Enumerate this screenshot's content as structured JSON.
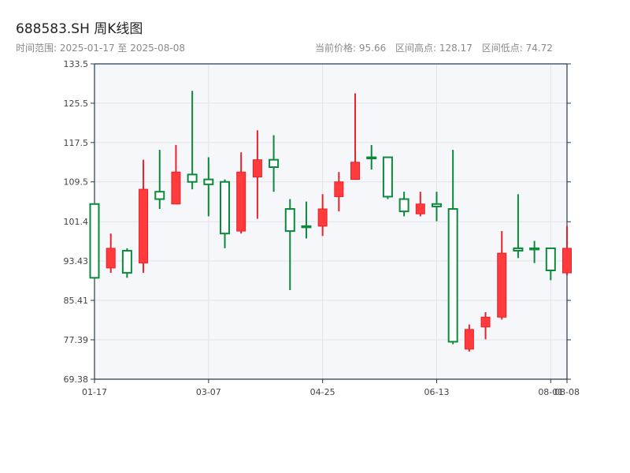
{
  "header": {
    "title": "688583.SH 周K线图",
    "date_range": "时间范围: 2025-01-17 至 2025-08-08",
    "current_price": "当前价格: 95.66",
    "range_high": "区间高点: 128.17",
    "range_low": "区间低点: 74.72"
  },
  "colors": {
    "up": "#e8212a",
    "up_fill": "#ff3b3b",
    "down": "#0a8a3a",
    "plot_bg": "#f5f7fa",
    "grid": "#e1e4e8",
    "axis": "#2b3a4a"
  },
  "chart_data": {
    "type": "candlestick",
    "title": "688583.SH 周K线图",
    "xlabel": "",
    "ylabel": "",
    "ylim": [
      69.38,
      133.5
    ],
    "y_ticks": [
      "69.38",
      "77.39",
      "85.41",
      "93.43",
      "101.4",
      "109.5",
      "117.5",
      "125.5",
      "133.5"
    ],
    "x_ticks": [
      "01-17",
      "03-07",
      "04-25",
      "06-13",
      "08-01",
      "08-08"
    ],
    "grid": true,
    "candles": [
      {
        "date": "2025-01-17",
        "open": 90.0,
        "close": 105.0,
        "high": 105.0,
        "low": 90.0
      },
      {
        "date": "2025-01-24",
        "open": 96.0,
        "close": 92.0,
        "high": 99.0,
        "low": 91.0
      },
      {
        "date": "2025-01-31",
        "open": 91.0,
        "close": 95.5,
        "high": 96.0,
        "low": 90.0
      },
      {
        "date": "2025-02-07",
        "open": 108.0,
        "close": 93.0,
        "high": 114.0,
        "low": 91.0
      },
      {
        "date": "2025-02-14",
        "open": 106.0,
        "close": 107.5,
        "high": 116.0,
        "low": 104.0
      },
      {
        "date": "2025-02-21",
        "open": 111.5,
        "close": 105.0,
        "high": 117.0,
        "low": 105.0
      },
      {
        "date": "2025-02-28",
        "open": 109.5,
        "close": 111.0,
        "high": 128.0,
        "low": 108.0
      },
      {
        "date": "2025-03-07",
        "open": 109.0,
        "close": 110.0,
        "high": 114.5,
        "low": 102.5
      },
      {
        "date": "2025-03-14",
        "open": 99.0,
        "close": 109.5,
        "high": 110.0,
        "low": 96.0
      },
      {
        "date": "2025-03-21",
        "open": 111.5,
        "close": 99.5,
        "high": 115.5,
        "low": 99.0
      },
      {
        "date": "2025-03-28",
        "open": 114.0,
        "close": 110.5,
        "high": 120.0,
        "low": 102.0
      },
      {
        "date": "2025-04-04",
        "open": 112.5,
        "close": 114.0,
        "high": 119.0,
        "low": 107.5
      },
      {
        "date": "2025-04-11",
        "open": 99.5,
        "close": 104.0,
        "high": 106.0,
        "low": 87.5
      },
      {
        "date": "2025-04-18",
        "open": 100.5,
        "close": 100.5,
        "high": 105.5,
        "low": 98.0
      },
      {
        "date": "2025-04-25",
        "open": 104.0,
        "close": 100.5,
        "high": 107.0,
        "low": 98.5
      },
      {
        "date": "2025-05-02",
        "open": 109.5,
        "close": 106.5,
        "high": 111.5,
        "low": 103.5
      },
      {
        "date": "2025-05-09",
        "open": 113.5,
        "close": 110.0,
        "high": 127.5,
        "low": 110.0
      },
      {
        "date": "2025-05-16",
        "open": 114.5,
        "close": 114.5,
        "high": 117.0,
        "low": 112.0
      },
      {
        "date": "2025-05-23",
        "open": 106.5,
        "close": 114.5,
        "high": 114.5,
        "low": 106.0
      },
      {
        "date": "2025-05-30",
        "open": 103.5,
        "close": 106.0,
        "high": 107.5,
        "low": 102.5
      },
      {
        "date": "2025-06-06",
        "open": 105.0,
        "close": 103.0,
        "high": 107.5,
        "low": 102.5
      },
      {
        "date": "2025-06-13",
        "open": 104.5,
        "close": 105.0,
        "high": 107.5,
        "low": 101.5
      },
      {
        "date": "2025-06-20",
        "open": 77.0,
        "close": 104.0,
        "high": 116.0,
        "low": 76.5
      },
      {
        "date": "2025-06-27",
        "open": 79.5,
        "close": 75.5,
        "high": 80.5,
        "low": 75.0
      },
      {
        "date": "2025-07-04",
        "open": 82.0,
        "close": 80.0,
        "high": 83.0,
        "low": 77.5
      },
      {
        "date": "2025-07-11",
        "open": 95.0,
        "close": 82.0,
        "high": 99.5,
        "low": 81.5
      },
      {
        "date": "2025-07-18",
        "open": 95.5,
        "close": 96.0,
        "high": 107.0,
        "low": 94.0
      },
      {
        "date": "2025-07-25",
        "open": 96.0,
        "close": 96.0,
        "high": 97.5,
        "low": 93.0
      },
      {
        "date": "2025-08-01",
        "open": 91.5,
        "close": 96.0,
        "high": 96.0,
        "low": 89.5
      },
      {
        "date": "2025-08-08",
        "open": 96.0,
        "close": 91.0,
        "high": 100.5,
        "low": 90.5
      }
    ]
  }
}
